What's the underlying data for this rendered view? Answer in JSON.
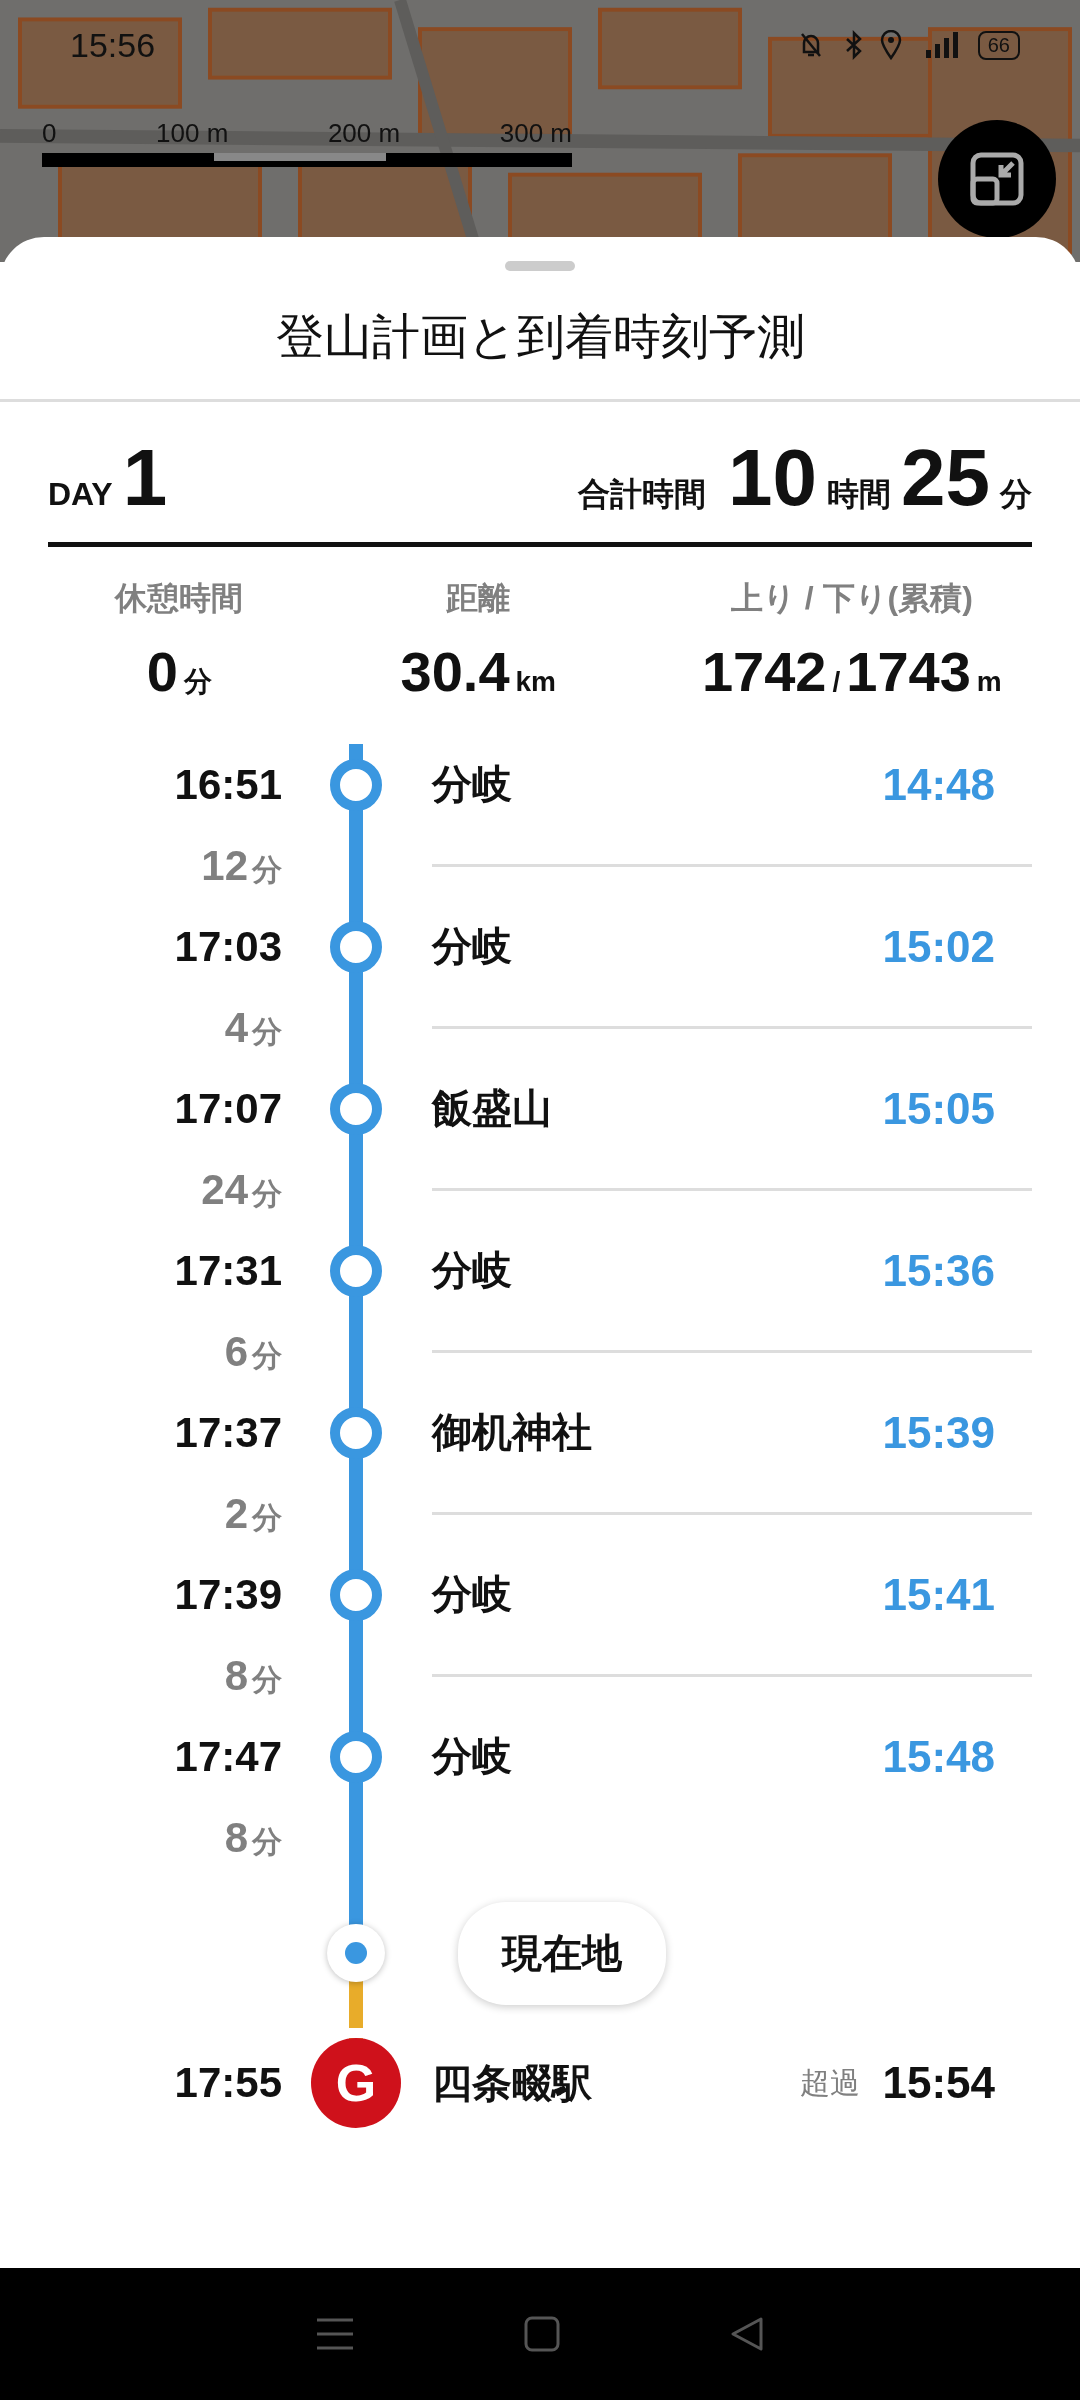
{
  "status_bar": {
    "time": "15:56",
    "battery": "66"
  },
  "map": {
    "scale_labels": [
      "0",
      "100 m",
      "200 m",
      "300 m"
    ]
  },
  "sheet": {
    "title": "登山計画と到着時刻予測"
  },
  "summary": {
    "day_label": "DAY",
    "day": "1",
    "total_label": "合計時間",
    "hours": "10",
    "hours_unit": "時間",
    "minutes": "25",
    "minutes_unit": "分"
  },
  "stats": [
    {
      "label": "休憩時間",
      "value": "0",
      "unit": "分"
    },
    {
      "label": "距離",
      "value": "30.4",
      "unit": "km"
    },
    {
      "label": "上り / 下り(累積)",
      "value": "1742",
      "separator": "/",
      "value2": "1743",
      "unit": "m"
    }
  ],
  "route": [
    {
      "kind": "point",
      "planned": "16:51",
      "name": "分岐",
      "actual": "14:48"
    },
    {
      "kind": "leg",
      "duration": "12",
      "unit": "分"
    },
    {
      "kind": "point",
      "planned": "17:03",
      "name": "分岐",
      "actual": "15:02"
    },
    {
      "kind": "leg",
      "duration": "4",
      "unit": "分"
    },
    {
      "kind": "point",
      "planned": "17:07",
      "name": "飯盛山",
      "actual": "15:05"
    },
    {
      "kind": "leg",
      "duration": "24",
      "unit": "分"
    },
    {
      "kind": "point",
      "planned": "17:31",
      "name": "分岐",
      "actual": "15:36"
    },
    {
      "kind": "leg",
      "duration": "6",
      "unit": "分"
    },
    {
      "kind": "point",
      "planned": "17:37",
      "name": "御机神社",
      "actual": "15:39"
    },
    {
      "kind": "leg",
      "duration": "2",
      "unit": "分"
    },
    {
      "kind": "point",
      "planned": "17:39",
      "name": "分岐",
      "actual": "15:41"
    },
    {
      "kind": "leg",
      "duration": "8",
      "unit": "分"
    },
    {
      "kind": "point",
      "planned": "17:47",
      "name": "分岐",
      "actual": "15:48"
    },
    {
      "kind": "leg",
      "duration": "8",
      "unit": "分"
    },
    {
      "kind": "current",
      "label": "現在地"
    },
    {
      "kind": "goal",
      "planned": "17:55",
      "marker": "G",
      "name": "四条畷駅",
      "note": "超過",
      "actual": "15:54"
    }
  ]
}
